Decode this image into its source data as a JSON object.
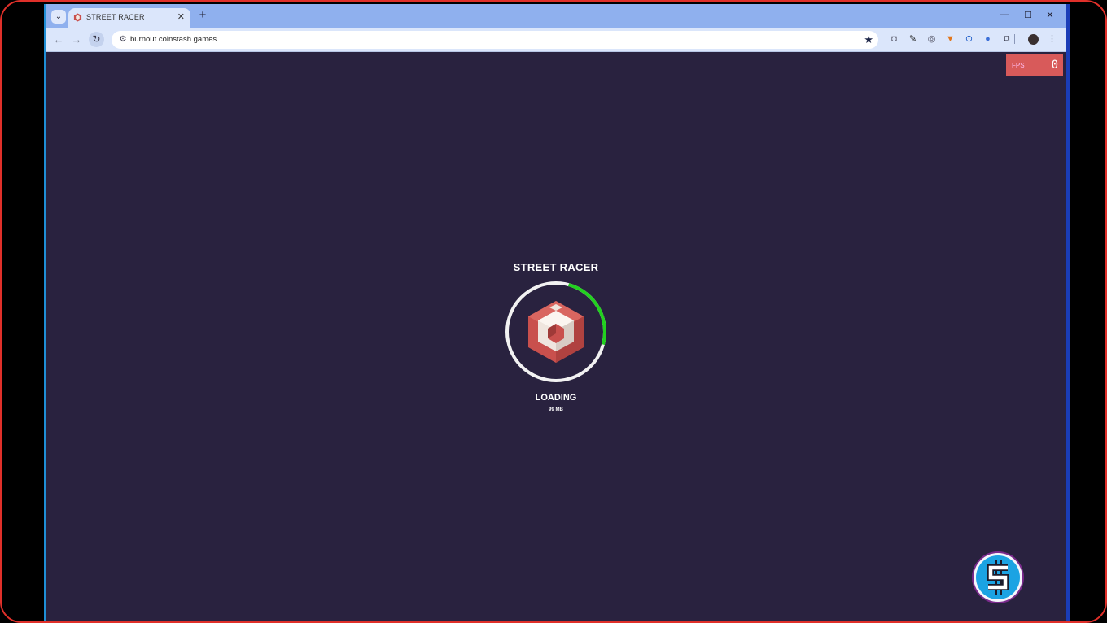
{
  "browser": {
    "tab": {
      "title": "STREET RACER",
      "close_label": "✕"
    },
    "new_tab_label": "+",
    "window_controls": {
      "minimize": "—",
      "maximize": "☐",
      "close": "✕"
    },
    "toolbar": {
      "back": "←",
      "forward": "→",
      "reload": "↻",
      "url": "burnout.coinstash.games",
      "bookmark": "★"
    },
    "extensions": [
      "camera-icon",
      "eyedropper-icon",
      "target-icon",
      "fox-icon",
      "ring-icon",
      "circle-icon",
      "puzzle-icon",
      "avatar",
      "menu-icon"
    ]
  },
  "page": {
    "fps": {
      "label": "FPS",
      "value": "0"
    },
    "loader": {
      "title": "STREET RACER",
      "status": "LOADING",
      "size": "99 MB",
      "progress": 0.25
    }
  },
  "colors": {
    "background": "#29223f",
    "progress": "#22d11f",
    "logo_red": "#c9504d",
    "coin": "#1ba3e3"
  }
}
